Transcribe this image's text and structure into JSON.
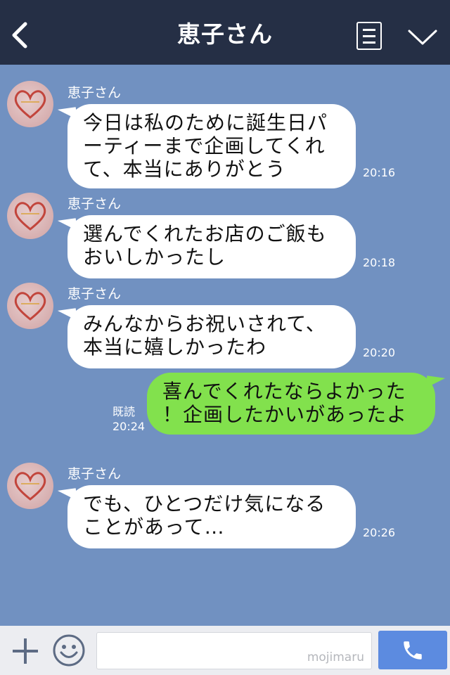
{
  "header": {
    "title": "恵子さん",
    "icons": [
      "back-chevron-icon",
      "menu-list-icon",
      "chevron-down-icon"
    ]
  },
  "messages": [
    {
      "sender": "恵子さん",
      "lines": [
        "今日は私のために誕生日パ",
        "ーティーまで企画してくれ",
        "て、本当にありがとう"
      ],
      "time": "20:16",
      "direction": "incoming"
    },
    {
      "sender": "恵子さん",
      "lines": [
        "選んでくれたお店のご飯も",
        "おいしかったし"
      ],
      "time": "20:18",
      "direction": "incoming"
    },
    {
      "sender": "恵子さん",
      "lines": [
        "みんなからお祝いされて、",
        "本当に嬉しかったわ"
      ],
      "time": "20:20",
      "direction": "incoming"
    },
    {
      "lines": [
        "喜んでくれたならよかった",
        "！企画したかいがあったよ"
      ],
      "read": "既読",
      "time": "20:24",
      "direction": "outgoing"
    },
    {
      "sender": "恵子さん",
      "lines": [
        "でも、ひとつだけ気になる",
        "ことがあって…"
      ],
      "time": "20:26",
      "direction": "incoming"
    }
  ],
  "footer": {
    "input_value": "",
    "watermark": "mojimaru",
    "icons": [
      "plus-icon",
      "smiley-icon",
      "phone-icon"
    ]
  },
  "colors": {
    "header_bg": "#252f45",
    "chat_bg": "#7191c1",
    "incoming_bubble": "#ffffff",
    "outgoing_bubble": "#82e14d",
    "call_button": "#5c8be0"
  }
}
